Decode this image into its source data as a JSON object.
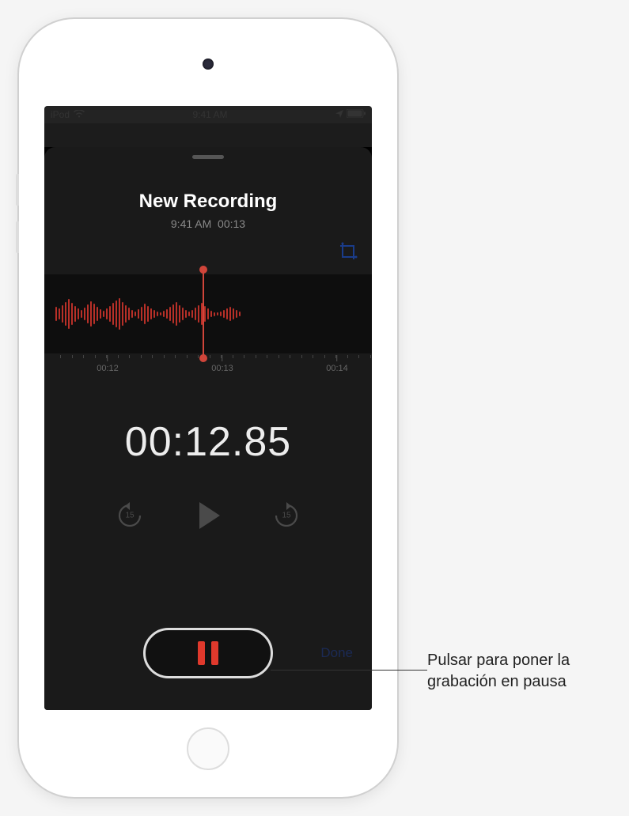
{
  "status_bar": {
    "carrier": "iPod",
    "time": "9:41 AM"
  },
  "recording": {
    "title": "New Recording",
    "time_label": "9:41 AM",
    "duration_label": "00:13",
    "elapsed": "00:12.85"
  },
  "ruler": {
    "ticks": [
      "00:12",
      "00:13",
      "00:14"
    ]
  },
  "controls": {
    "skip_seconds": "15",
    "done_label": "Done"
  },
  "callout": {
    "text": "Pulsar para poner la grabación en pausa"
  },
  "colors": {
    "accent_red": "#e0392c",
    "waveform_red": "#b83028",
    "panel_bg": "#1a1a1a"
  },
  "waveform_heights": [
    18,
    14,
    22,
    30,
    38,
    28,
    20,
    14,
    10,
    16,
    24,
    32,
    26,
    18,
    12,
    8,
    14,
    20,
    28,
    34,
    40,
    30,
    22,
    16,
    10,
    6,
    12,
    18,
    26,
    20,
    14,
    10,
    6,
    4,
    8,
    12,
    18,
    24,
    30,
    22,
    16,
    10,
    6,
    10,
    16,
    22,
    28,
    20,
    14,
    8,
    5,
    4,
    6,
    10,
    14,
    18,
    14,
    10,
    6
  ]
}
